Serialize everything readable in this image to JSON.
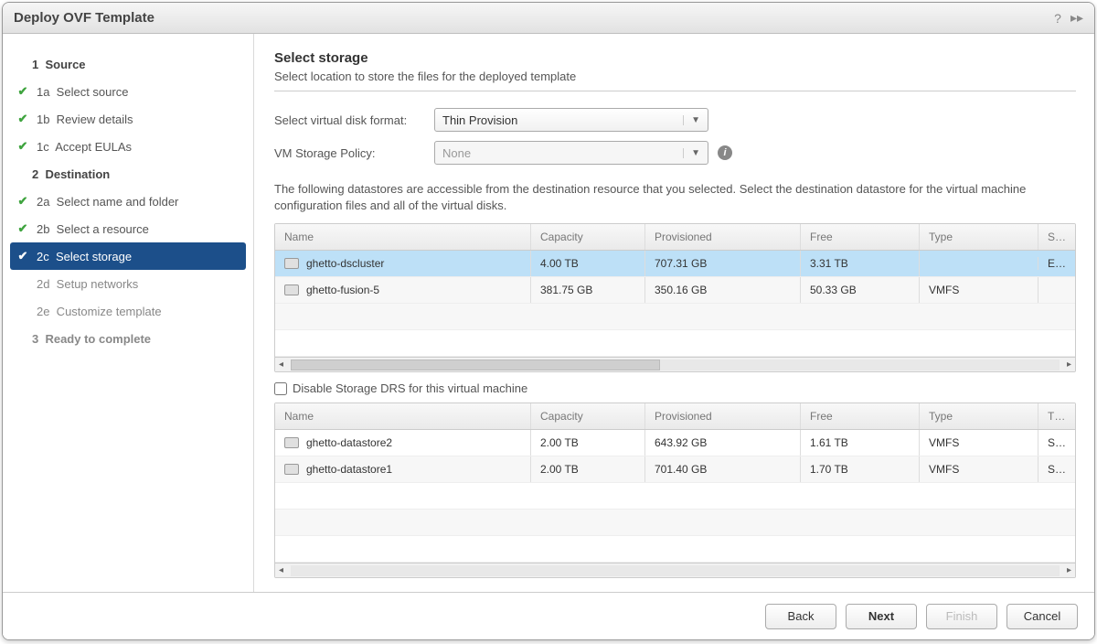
{
  "title": "Deploy OVF Template",
  "sidebar": {
    "items": [
      {
        "num": "1",
        "label": "Source",
        "section": true,
        "checked": false,
        "active": false
      },
      {
        "num": "1a",
        "label": "Select source",
        "section": false,
        "checked": true,
        "active": false
      },
      {
        "num": "1b",
        "label": "Review details",
        "section": false,
        "checked": true,
        "active": false
      },
      {
        "num": "1c",
        "label": "Accept EULAs",
        "section": false,
        "checked": true,
        "active": false
      },
      {
        "num": "2",
        "label": "Destination",
        "section": true,
        "checked": false,
        "active": false
      },
      {
        "num": "2a",
        "label": "Select name and folder",
        "section": false,
        "checked": true,
        "active": false
      },
      {
        "num": "2b",
        "label": "Select a resource",
        "section": false,
        "checked": true,
        "active": false
      },
      {
        "num": "2c",
        "label": "Select storage",
        "section": false,
        "checked": true,
        "active": true
      },
      {
        "num": "2d",
        "label": "Setup networks",
        "section": false,
        "checked": false,
        "active": false,
        "disabled": true
      },
      {
        "num": "2e",
        "label": "Customize template",
        "section": false,
        "checked": false,
        "active": false,
        "disabled": true
      },
      {
        "num": "3",
        "label": "Ready to complete",
        "section": true,
        "checked": false,
        "active": false,
        "disabled": true
      }
    ]
  },
  "main": {
    "title": "Select storage",
    "subtitle": "Select location to store the files for the deployed template",
    "disk_format_label": "Select virtual disk format:",
    "disk_format_value": "Thin Provision",
    "storage_policy_label": "VM Storage Policy:",
    "storage_policy_value": "None",
    "desc": "The following datastores are accessible from the destination resource that you selected. Select the destination datastore for the virtual machine configuration files and all of the virtual disks.",
    "table1": {
      "headers": {
        "name": "Name",
        "capacity": "Capacity",
        "provisioned": "Provisioned",
        "free": "Free",
        "type": "Type",
        "drs": "Storage DRS"
      },
      "rows": [
        {
          "icon": "cluster",
          "name": "ghetto-dscluster",
          "capacity": "4.00 TB",
          "provisioned": "707.31 GB",
          "free": "3.31 TB",
          "type": "",
          "drs": "Enabled",
          "selected": true
        },
        {
          "icon": "ds",
          "name": "ghetto-fusion-5",
          "capacity": "381.75 GB",
          "provisioned": "350.16 GB",
          "free": "50.33 GB",
          "type": "VMFS",
          "drs": ""
        }
      ]
    },
    "disable_drs_label": "Disable Storage DRS for this virtual machine",
    "table2": {
      "headers": {
        "name": "Name",
        "capacity": "Capacity",
        "provisioned": "Provisioned",
        "free": "Free",
        "type": "Type",
        "thp": "Thin Provision"
      },
      "rows": [
        {
          "name": "ghetto-datastore2",
          "capacity": "2.00 TB",
          "provisioned": "643.92 GB",
          "free": "1.61 TB",
          "type": "VMFS",
          "thp": "Supported"
        },
        {
          "name": "ghetto-datastore1",
          "capacity": "2.00 TB",
          "provisioned": "701.40 GB",
          "free": "1.70 TB",
          "type": "VMFS",
          "thp": "Supported"
        }
      ]
    }
  },
  "footer": {
    "back": "Back",
    "next": "Next",
    "finish": "Finish",
    "cancel": "Cancel"
  }
}
